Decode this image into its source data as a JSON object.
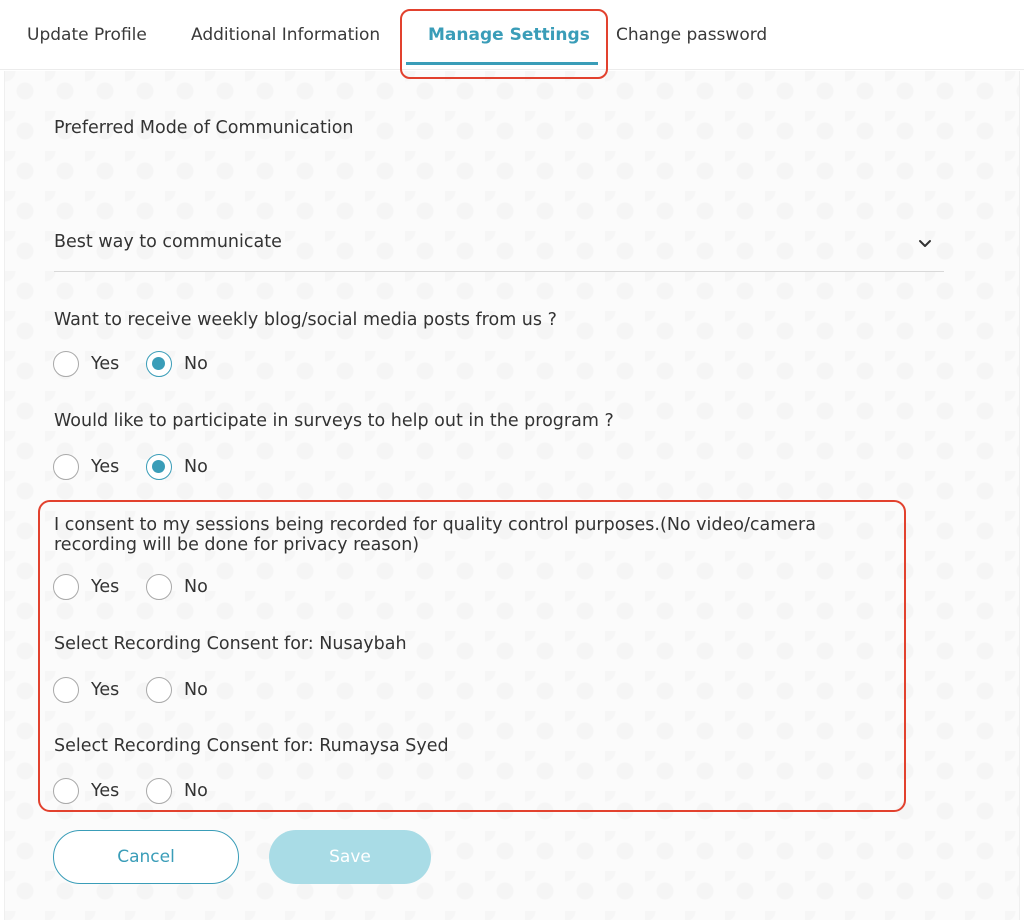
{
  "tabs": [
    {
      "label": "Update Profile"
    },
    {
      "label": "Additional Information"
    },
    {
      "label": "Manage Settings"
    },
    {
      "label": "Change password"
    }
  ],
  "active_tab": "Manage Settings",
  "section_title": "Preferred Mode of Communication",
  "communication_select": {
    "value": "Best way to communicate"
  },
  "questions": [
    {
      "text": "Want to receive weekly blog/social media posts from us ?",
      "yes": "Yes",
      "no": "No",
      "selected": "No"
    },
    {
      "text": "Would like to participate in surveys to help out in the program ?",
      "yes": "Yes",
      "no": "No",
      "selected": "No"
    },
    {
      "text": "I consent to my sessions being recorded for quality control purposes.(No video/camera recording will be done for privacy reason)",
      "yes": "Yes",
      "no": "No",
      "selected": ""
    },
    {
      "text": "Select Recording Consent for: Nusaybah",
      "yes": "Yes",
      "no": "No",
      "selected": ""
    },
    {
      "text": "Select Recording Consent for: Rumaysa Syed",
      "yes": "Yes",
      "no": "No",
      "selected": ""
    }
  ],
  "buttons": {
    "cancel": "Cancel",
    "save": "Save"
  },
  "colors": {
    "accent": "#3a9db8",
    "highlight": "#e2412e",
    "save_disabled": "#a9dce6"
  },
  "icons": {
    "select": "chevron-down-icon"
  }
}
